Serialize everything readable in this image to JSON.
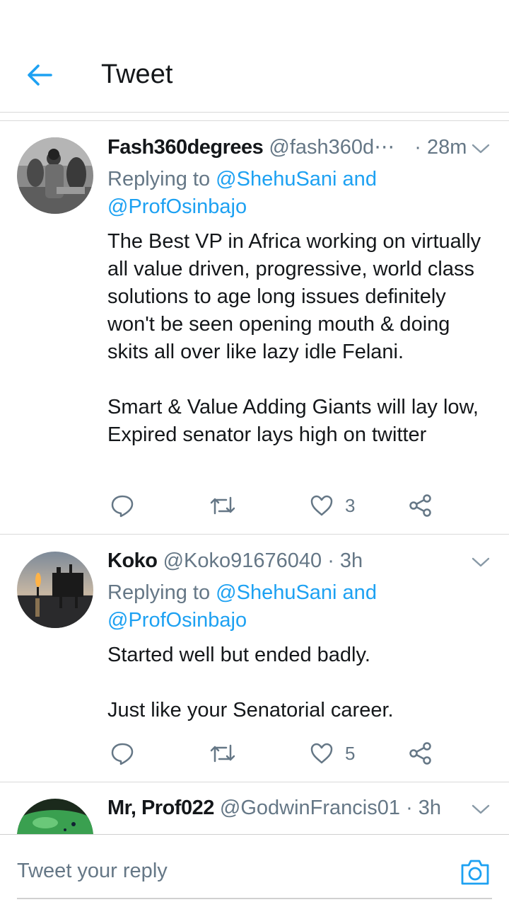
{
  "header": {
    "title": "Tweet",
    "back_icon": "arrow-left-icon",
    "accent": "#1da1f2"
  },
  "tweets": [
    {
      "name": "Fash360degrees",
      "handle": "@fash360d⋯",
      "time": "· 28m",
      "replying_prefix": "Replying to ",
      "replying_mention1": "@ShehuSani",
      "replying_and": " and",
      "replying_mention2": "@ProfOsinbajo",
      "text": "The Best VP in Africa working on virtually all value driven, progressive, world class solutions to age long issues definitely won't be seen opening mouth & doing skits all over like lazy idle Felani.\n\nSmart & Value Adding Giants will lay low,\nExpired senator lays high on twitter",
      "likes": "3"
    },
    {
      "name": "Koko",
      "handle": "@Koko91676040",
      "time": "· 3h",
      "replying_prefix": "Replying to ",
      "replying_mention1": "@ShehuSani",
      "replying_and": " and",
      "replying_mention2": "@ProfOsinbajo",
      "text": "Started well but ended badly.\n\nJust like your Senatorial career.",
      "likes": "5"
    },
    {
      "name": "Mr, Prof022",
      "handle": "@GodwinFrancis01",
      "time": "· 3h"
    }
  ],
  "reply_bar": {
    "placeholder": "Tweet your reply",
    "camera_icon": "camera-icon"
  },
  "colors": {
    "text": "#14171a",
    "secondary": "#657786",
    "link": "#1da1f2",
    "divider": "#d9d9d9"
  }
}
